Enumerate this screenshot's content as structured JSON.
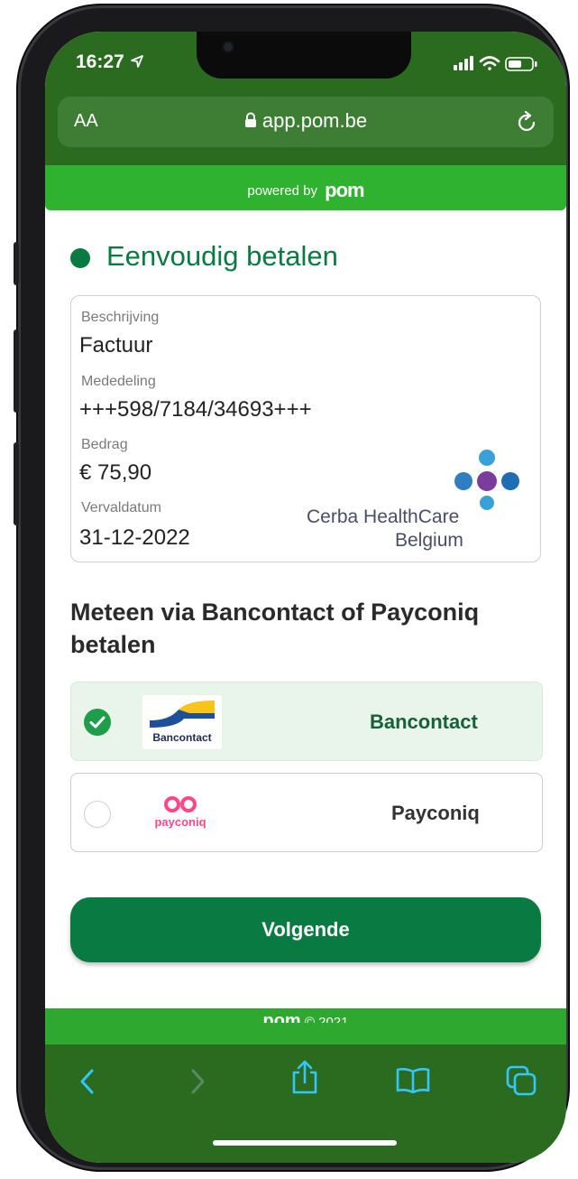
{
  "status": {
    "time": "16:27"
  },
  "browser": {
    "text_size_label": "AA",
    "url": "app.pom.be"
  },
  "banner": {
    "powered_by": "powered by",
    "logo": "pom"
  },
  "page": {
    "title": "Eenvoudig betalen"
  },
  "invoice": {
    "description_label": "Beschrijving",
    "description": "Factuur",
    "communication_label": "Mededeling",
    "communication": "+++598/7184/34693+++",
    "amount_label": "Bedrag",
    "amount": "€ 75,90",
    "due_label": "Vervaldatum",
    "due": "31-12-2022",
    "merchant_line1": "Cerba HealthCare",
    "merchant_line2": "Belgium"
  },
  "payment": {
    "heading": "Meteen via Bancontact of Payconiq betalen",
    "options": [
      {
        "name": "Bancontact",
        "logo_text": "Bancontact",
        "selected": true
      },
      {
        "name": "Payconiq",
        "logo_text": "payconiq",
        "selected": false
      }
    ]
  },
  "actions": {
    "next": "Volgende"
  },
  "footer": {
    "text": "© 2021"
  },
  "colors": {
    "brand_green": "#097a41",
    "bar_green": "#2a6b20",
    "banner_green": "#2fb22f",
    "ios_blue": "#34c6ff"
  }
}
